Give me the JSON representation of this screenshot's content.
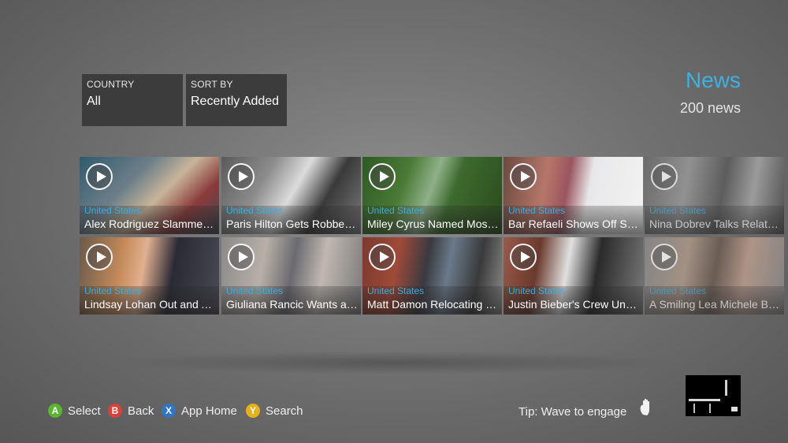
{
  "filters": {
    "country": {
      "label": "COUNTRY",
      "value": "All"
    },
    "sort": {
      "label": "SORT BY",
      "value": "Recently Added"
    }
  },
  "header": {
    "title": "News",
    "count": "200 news"
  },
  "colors": {
    "accent": "#3ab2e3",
    "a_button": "#5cb531",
    "b_button": "#d9413b",
    "x_button": "#2f77c5",
    "y_button": "#e5b11c"
  },
  "tiles": [
    {
      "country": "United States",
      "title": "Alex Rodriguez Slammed…",
      "icon": "play-icon"
    },
    {
      "country": "United States",
      "title": "Paris Hilton Gets Robbed…",
      "icon": "play-icon"
    },
    {
      "country": "United States",
      "title": "Miley Cyrus Named Mos…",
      "icon": "play-icon"
    },
    {
      "country": "United States",
      "title": "Bar Refaeli Shows Off Str…",
      "icon": "play-icon"
    },
    {
      "country": "United States",
      "title": "Nina Dobrev Talks Relati…",
      "icon": "play-icon"
    },
    {
      "country": "United States",
      "title": "Lindsay Lohan Out and A…",
      "icon": "play-icon"
    },
    {
      "country": "United States",
      "title": "Giuliana Rancic Wants a …",
      "icon": "play-icon"
    },
    {
      "country": "United States",
      "title": "Matt Damon Relocating …",
      "icon": "play-icon"
    },
    {
      "country": "United States",
      "title": "Justin Bieber's Crew Und…",
      "icon": "play-icon"
    },
    {
      "country": "United States",
      "title": "A Smiling Lea Michele Br…",
      "icon": "play-icon"
    }
  ],
  "controls": {
    "a": {
      "glyph": "A",
      "label": "Select"
    },
    "b": {
      "glyph": "B",
      "label": "Back"
    },
    "x": {
      "glyph": "X",
      "label": "App Home"
    },
    "y": {
      "glyph": "Y",
      "label": "Search"
    }
  },
  "tip": "Tip: Wave to engage"
}
